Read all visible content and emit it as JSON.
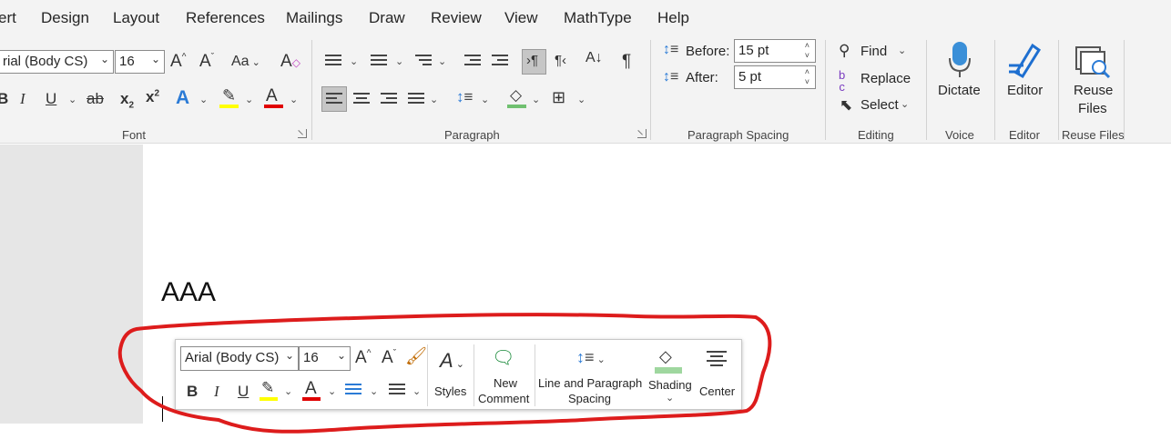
{
  "menu": {
    "tabs": [
      "ert",
      "Design",
      "Layout",
      "References",
      "Mailings",
      "Draw",
      "Review",
      "View",
      "MathType",
      "Help"
    ]
  },
  "font_group": {
    "font_name": "rial (Body CS)",
    "font_size": "16",
    "change_case": "Aa",
    "label": "Font",
    "colors": {
      "highlight": "#ffff00",
      "font_color": "#e00000",
      "text_effects": "#2b7bd6"
    }
  },
  "paragraph_group": {
    "label": "Paragraph",
    "shading_color": "#70c070"
  },
  "spacing_group": {
    "before_label": "Before:",
    "before_value": "15 pt",
    "after_label": "After:",
    "after_value": "5 pt",
    "label": "Paragraph Spacing"
  },
  "editing_group": {
    "find": "Find",
    "replace": "Replace",
    "select": "Select",
    "label": "Editing"
  },
  "voice_group": {
    "dictate": "Dictate",
    "label": "Voice"
  },
  "editor_group": {
    "editor": "Editor",
    "label": "Editor"
  },
  "reuse_group": {
    "reuse_line1": "Reuse",
    "reuse_line2": "Files",
    "label": "Reuse Files"
  },
  "document": {
    "text": "AAA"
  },
  "mini_toolbar": {
    "font_name": "Arial (Body CS)",
    "font_size": "16",
    "styles": "Styles",
    "new_comment_1": "New",
    "new_comment_2": "Comment",
    "line_spacing_1": "Line and Paragraph",
    "line_spacing_2": "Spacing",
    "shading": "Shading",
    "center": "Center",
    "annotation_color": "#dd1c1c"
  }
}
